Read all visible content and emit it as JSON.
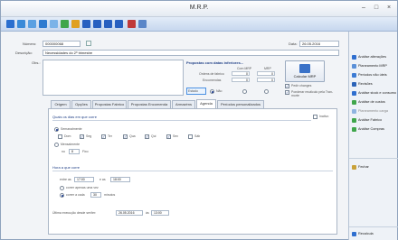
{
  "window": {
    "title": "M.R.P."
  },
  "header": {
    "numero_label": "Número:",
    "numero_value": "000000068",
    "data_label": "Data:",
    "data_value": "26.05.2016",
    "descricao_label": "Descrição:",
    "descricao_value": "Necessidades do 2º trimestre",
    "obs_label": "Obs.:",
    "dropdown_value": "Opções várias ecrã"
  },
  "props": {
    "title": "Propostas com datas inferiores...",
    "col1": "Com MRP",
    "col2": "MRP",
    "row1_label": "Ordens de fabrico",
    "row1_v1": "0",
    "row1_v2": "0",
    "row2_label": "Encomendas",
    "row2_v1": "0",
    "row2_v2": "0",
    "estado_label": "Estado",
    "opt_nao": "Não",
    "chk1_label": "Pedir changes",
    "chk2_label": "Ponderar recálculo pela Tran-morte"
  },
  "calc": {
    "label": "Calcular MRP"
  },
  "tabs": [
    "Origem",
    "Opções",
    "Propostas Fabrico",
    "Propostas Encomenda",
    "Armazéns",
    "Agenda",
    "Períodos personalizados"
  ],
  "panel": {
    "sec1_title": "Quais os dias em que corre",
    "ativo_label": "Inativo",
    "opt_semana": "Semanalmente",
    "days": [
      "Dom",
      "Seg",
      "Ter",
      "Qua",
      "Qui",
      "Sex",
      "Sáb"
    ],
    "days_checked": [
      false,
      true,
      true,
      true,
      true,
      true,
      false
    ],
    "opt_mensal": "Mensalmente",
    "cada_label": "no",
    "cada_value": "8",
    "cada_suffix": "Fixo",
    "sec2_title": "Hora a que corre",
    "entre_label": "entre as",
    "entre_value": "17:00",
    "ate_label": "e as",
    "ate_value": "18:00",
    "opt_uma": "correr apenas uma vez",
    "opt_cada": "correr a cada",
    "cada_min": "30",
    "min_suffix": "minutos",
    "ult_label": "Última execução desde ser/ter:",
    "ult_date": "26.05.2016",
    "ult_as": "às",
    "ult_time": "13:00"
  },
  "side": {
    "items": [
      "Análise alterações",
      "Planeamento MRP",
      "Períodos não úteis",
      "Revisões",
      "Análise stock e consumo",
      "Análise de custos",
      "Planeamento carga",
      "Análise Fabrico",
      "Análise Compras"
    ],
    "fechar": "Fechar",
    "recalcula": "Recalcula"
  }
}
